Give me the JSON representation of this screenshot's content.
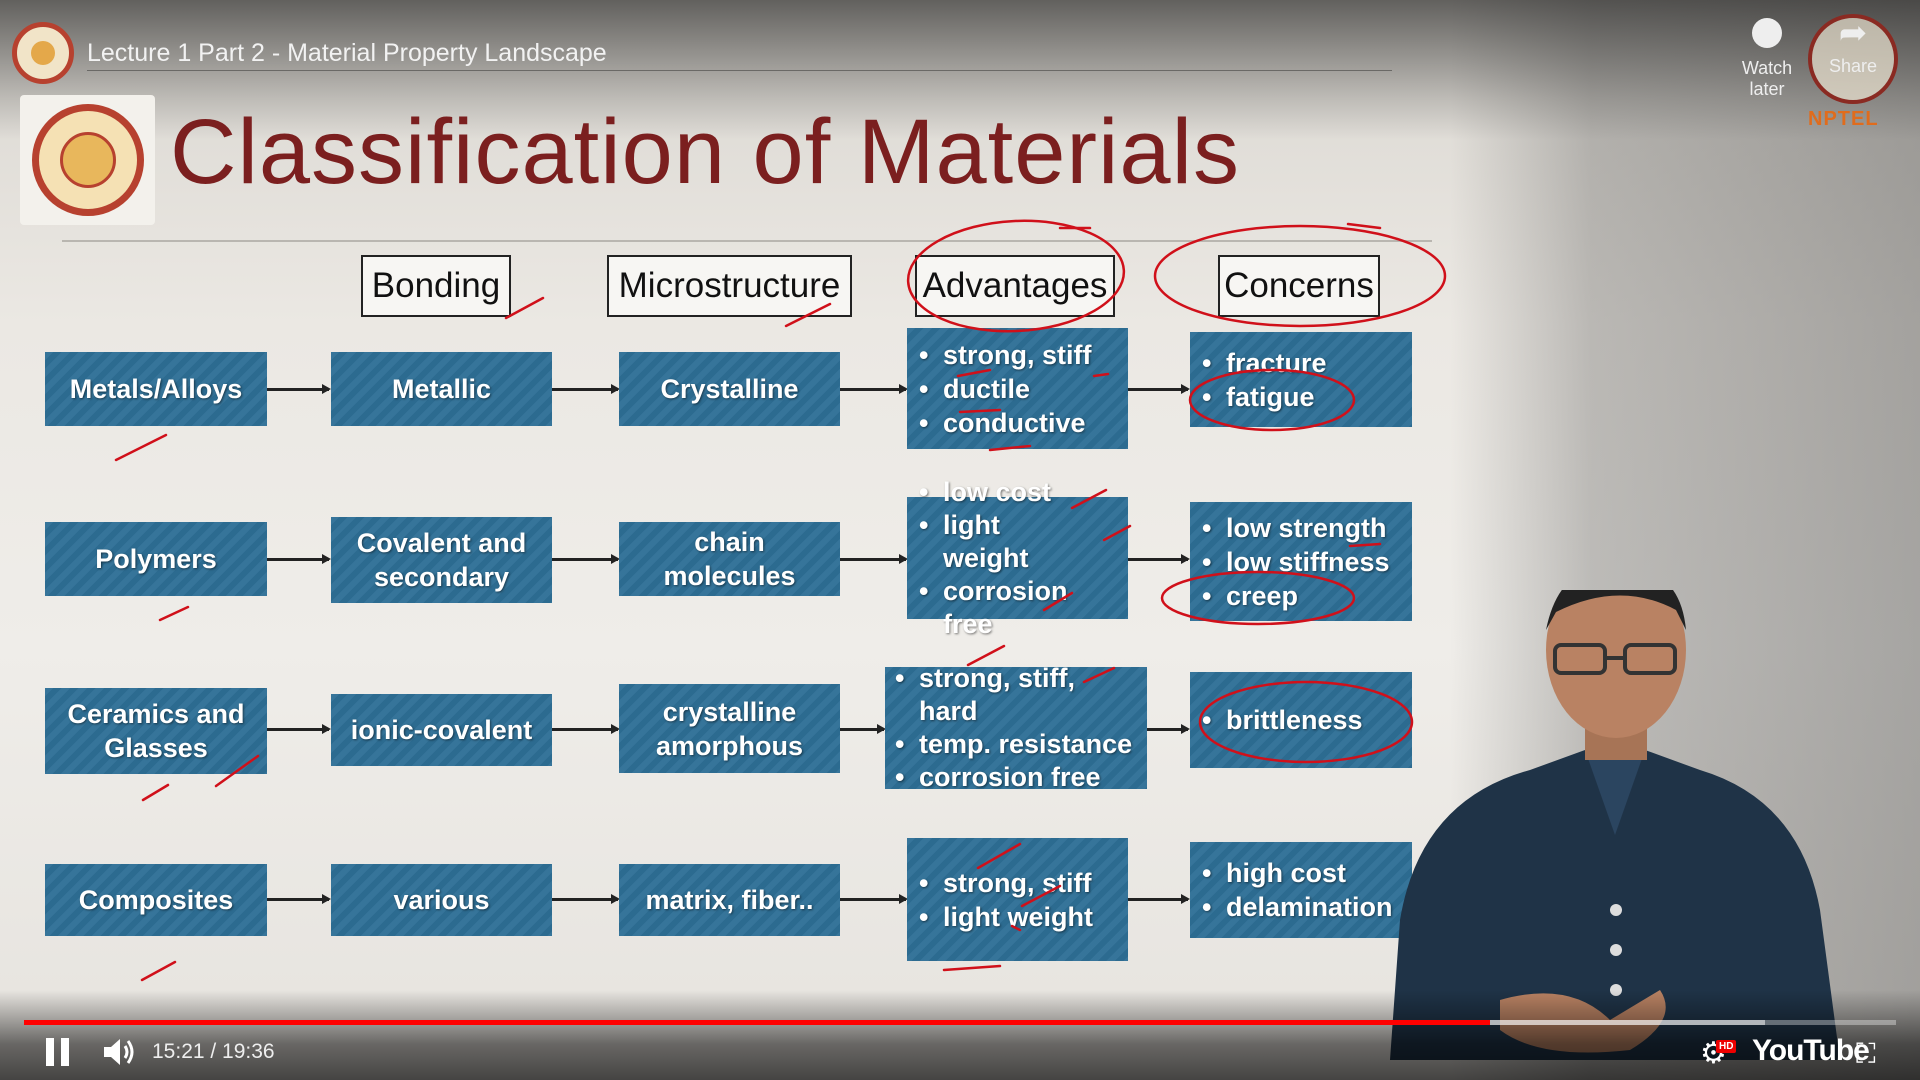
{
  "player": {
    "video_title": "Lecture 1 Part 2 - Material Property Landscape",
    "watch_later_label": "Watch later",
    "share_label": "Share",
    "channel_watermark": "NPTEL",
    "time_current": "15:21",
    "time_separator": "/",
    "time_total": "19:36",
    "time_text": "15:21 / 19:36",
    "progress_fraction": 0.783,
    "buffer_fraction": 0.93,
    "youtube_label": "YouTube",
    "hd_badge": "HD",
    "icons": {
      "pause": "pause-icon",
      "volume": "volume-icon",
      "settings": "gear-icon",
      "fullscreen": "exit-fullscreen-icon",
      "watch_later": "clock-icon",
      "share": "share-arrow-icon"
    },
    "colors": {
      "progress": "#ff0000",
      "nptel": "#e06c1d"
    }
  },
  "slide": {
    "title": "Classification of Materials",
    "columns": {
      "bonding": "Bonding",
      "microstructure": "Microstructure",
      "advantages": "Advantages",
      "concerns": "Concerns"
    },
    "rows": [
      {
        "material": "Metals/Alloys",
        "bonding": "Metallic",
        "microstructure": "Crystalline",
        "advantages": [
          "strong, stiff",
          "ductile",
          "conductive"
        ],
        "concerns": [
          "fracture",
          "fatigue"
        ]
      },
      {
        "material": "Polymers",
        "bonding": "Covalent and secondary",
        "microstructure": "chain molecules",
        "advantages": [
          "low cost",
          "light weight",
          "corrosion free"
        ],
        "concerns": [
          "low strength",
          "low stiffness",
          "creep"
        ]
      },
      {
        "material": "Ceramics and Glasses",
        "bonding": "ionic-covalent",
        "microstructure": "crystalline amorphous",
        "advantages": [
          "strong, stiff, hard",
          "temp. resistance",
          "corrosion free"
        ],
        "concerns": [
          "brittleness"
        ]
      },
      {
        "material": "Composites",
        "bonding": "various",
        "microstructure": "matrix, fiber..",
        "advantages": [
          "strong, stiff",
          "light weight"
        ],
        "concerns": [
          "high cost",
          "delamination"
        ]
      }
    ],
    "colors": {
      "title": "#7b1f1f",
      "box": "#2e6f96",
      "annotation": "#d0101a"
    }
  }
}
